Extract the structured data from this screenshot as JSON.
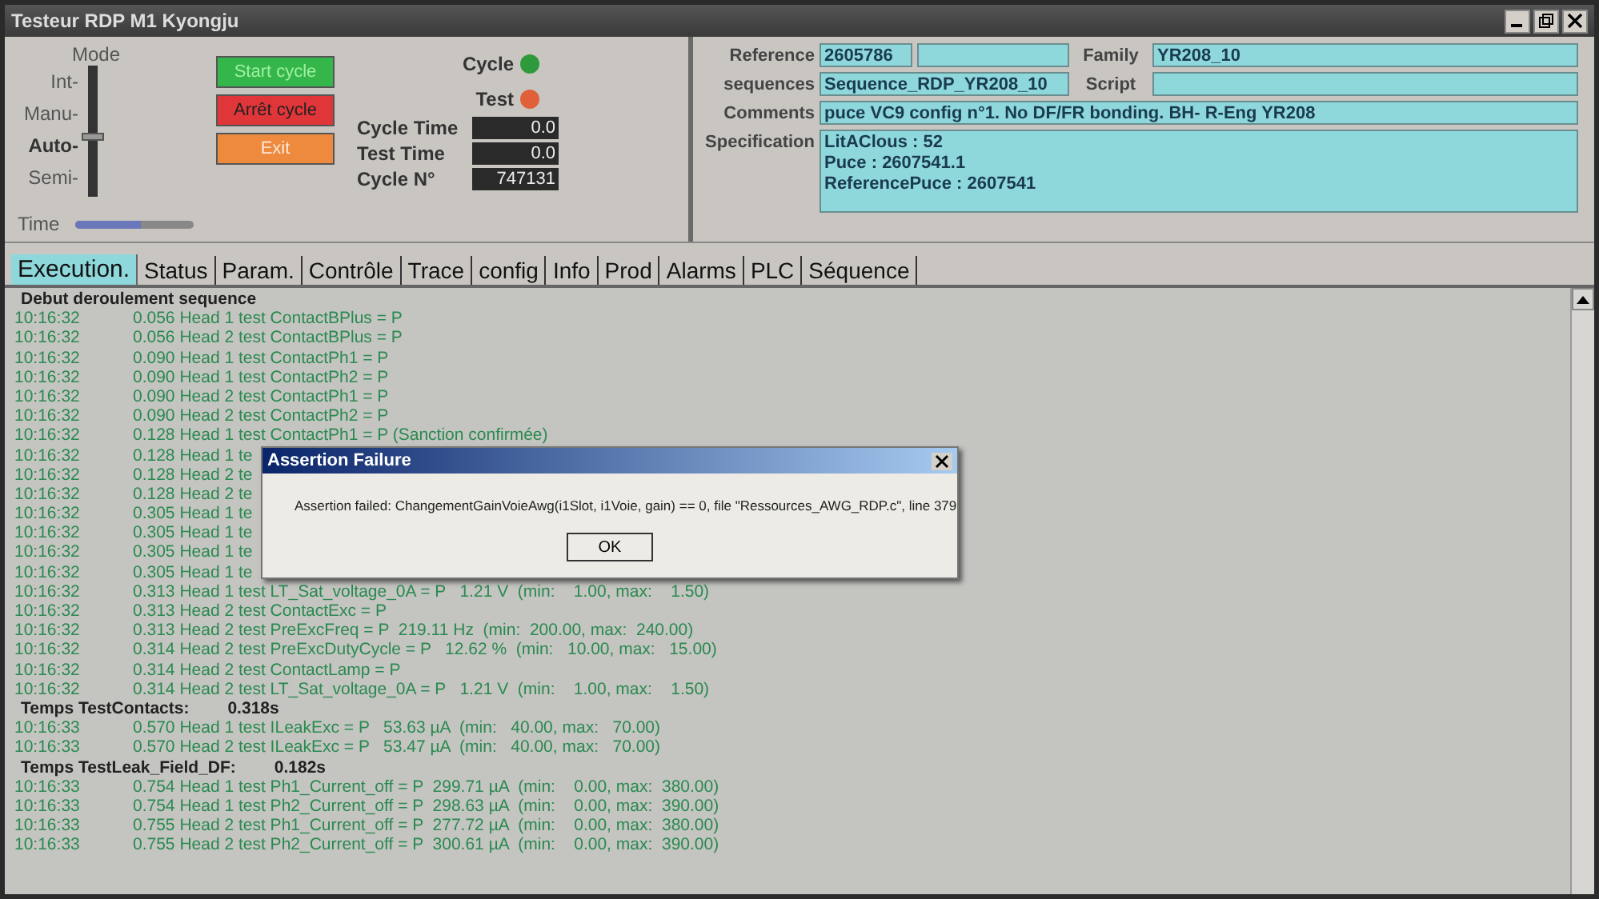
{
  "window": {
    "title": "Testeur RDP M1 Kyongju"
  },
  "mode": {
    "title": "Mode",
    "positions": [
      {
        "label": "Int-",
        "selected": false
      },
      {
        "label": "Manu-",
        "selected": false
      },
      {
        "label": "Auto-",
        "selected": true
      },
      {
        "label": "Semi-",
        "selected": false
      }
    ]
  },
  "buttons": [
    {
      "label": "Start cycle",
      "kind": "start"
    },
    {
      "label": "Arrêt cycle",
      "kind": "stop"
    },
    {
      "label": "Exit",
      "kind": "exit"
    }
  ],
  "time_slider": {
    "label": "Time",
    "level": 0.55
  },
  "indicators": [
    {
      "label": "Cycle",
      "color": "#2e9a3c"
    },
    {
      "label": "Test",
      "color": "#e0603a"
    }
  ],
  "counters": [
    {
      "label": "Cycle Time",
      "value": "0.0"
    },
    {
      "label": "Test Time",
      "value": "0.0"
    },
    {
      "label": "Cycle N°",
      "value": "747131"
    }
  ],
  "info": {
    "reference_label": "Reference",
    "reference": "2605786",
    "family_label": "Family",
    "family": "YR208_10",
    "sequences_label": "sequences",
    "sequence": "Sequence_RDP_YR208_10",
    "script_label": "Script",
    "comments_label": "Comments",
    "comments": "puce VC9 config n°1. No DF/FR bonding. BH- R-Eng YR208",
    "specification_label": "Specification",
    "specification": [
      "LitAClous : 52",
      "Puce : 2607541.1",
      "ReferencePuce : 2607541"
    ]
  },
  "tabs": [
    {
      "label": "Execution.",
      "selected": true
    },
    {
      "label": "Status",
      "selected": false
    },
    {
      "label": "Param.",
      "selected": false
    },
    {
      "label": "Contrôle",
      "selected": false
    },
    {
      "label": "Trace",
      "selected": false
    },
    {
      "label": "config",
      "selected": false
    },
    {
      "label": "Info",
      "selected": false
    },
    {
      "label": "Prod",
      "selected": false
    },
    {
      "label": "Alarms",
      "selected": false
    },
    {
      "label": "PLC",
      "selected": false
    },
    {
      "label": "Séquence",
      "selected": false
    }
  ],
  "log": [
    {
      "kind": "heading",
      "label": "Debut deroulement sequence"
    },
    {
      "kind": "entry",
      "time": "10:16:32",
      "text": "0.056 Head 1 test ContactBPlus = P"
    },
    {
      "kind": "entry",
      "time": "10:16:32",
      "text": "0.056 Head 2 test ContactBPlus = P"
    },
    {
      "kind": "entry",
      "time": "10:16:32",
      "text": "0.090 Head 1 test ContactPh1 = P"
    },
    {
      "kind": "entry",
      "time": "10:16:32",
      "text": "0.090 Head 1 test ContactPh2 = P"
    },
    {
      "kind": "entry",
      "time": "10:16:32",
      "text": "0.090 Head 2 test ContactPh1 = P"
    },
    {
      "kind": "entry",
      "time": "10:16:32",
      "text": "0.090 Head 2 test ContactPh2 = P"
    },
    {
      "kind": "entry",
      "time": "10:16:32",
      "text": "0.128 Head 1 test ContactPh1 = P (Sanction confirmée)"
    },
    {
      "kind": "entry",
      "time": "10:16:32",
      "text": "0.128 Head 1 te"
    },
    {
      "kind": "entry",
      "time": "10:16:32",
      "text": "0.128 Head 2 te"
    },
    {
      "kind": "entry",
      "time": "10:16:32",
      "text": "0.128 Head 2 te"
    },
    {
      "kind": "entry",
      "time": "10:16:32",
      "text": "0.305 Head 1 te"
    },
    {
      "kind": "entry",
      "time": "10:16:32",
      "text": "0.305 Head 1 te"
    },
    {
      "kind": "entry",
      "time": "10:16:32",
      "text": "0.305 Head 1 te"
    },
    {
      "kind": "entry",
      "time": "10:16:32",
      "text": "0.305 Head 1 te"
    },
    {
      "kind": "entry",
      "time": "10:16:32",
      "text": "0.313 Head 1 test LT_Sat_voltage_0A = P   1.21 V  (min:    1.00, max:    1.50)"
    },
    {
      "kind": "entry",
      "time": "10:16:32",
      "text": "0.313 Head 2 test ContactExc = P"
    },
    {
      "kind": "entry",
      "time": "10:16:32",
      "text": "0.313 Head 2 test PreExcFreq = P  219.11 Hz  (min:  200.00, max:  240.00)"
    },
    {
      "kind": "entry",
      "time": "10:16:32",
      "text": "0.314 Head 2 test PreExcDutyCycle = P   12.62 %  (min:   10.00, max:   15.00)"
    },
    {
      "kind": "entry",
      "time": "10:16:32",
      "text": "0.314 Head 2 test ContactLamp = P"
    },
    {
      "kind": "entry",
      "time": "10:16:32",
      "text": "0.314 Head 2 test LT_Sat_voltage_0A = P   1.21 V  (min:    1.00, max:    1.50)"
    },
    {
      "kind": "heading",
      "label": "Temps TestContacts:",
      "value": "0.318s"
    },
    {
      "kind": "entry",
      "time": "10:16:33",
      "text": "0.570 Head 1 test ILeakExc = P   53.63 µA  (min:   40.00, max:   70.00)"
    },
    {
      "kind": "entry",
      "time": "10:16:33",
      "text": "0.570 Head 2 test ILeakExc = P   53.47 µA  (min:   40.00, max:   70.00)"
    },
    {
      "kind": "heading",
      "label": "Temps TestLeak_Field_DF:",
      "value": "0.182s"
    },
    {
      "kind": "entry",
      "time": "10:16:33",
      "text": "0.754 Head 1 test Ph1_Current_off = P  299.71 µA  (min:    0.00, max:  380.00)"
    },
    {
      "kind": "entry",
      "time": "10:16:33",
      "text": "0.754 Head 1 test Ph2_Current_off = P  298.63 µA  (min:    0.00, max:  390.00)"
    },
    {
      "kind": "entry",
      "time": "10:16:33",
      "text": "0.755 Head 2 test Ph1_Current_off = P  277.72 µA  (min:    0.00, max:  380.00)"
    },
    {
      "kind": "entry",
      "time": "10:16:33",
      "text": "0.755 Head 2 test Ph2_Current_off = P  300.61 µA  (min:    0.00, max:  390.00)"
    }
  ],
  "dialog": {
    "title": "Assertion Failure",
    "message": "Assertion failed: ChangementGainVoieAwg(i1Slot, i1Voie, gain) == 0, file \"Ressources_AWG_RDP.c\", line 379",
    "button": "OK"
  }
}
